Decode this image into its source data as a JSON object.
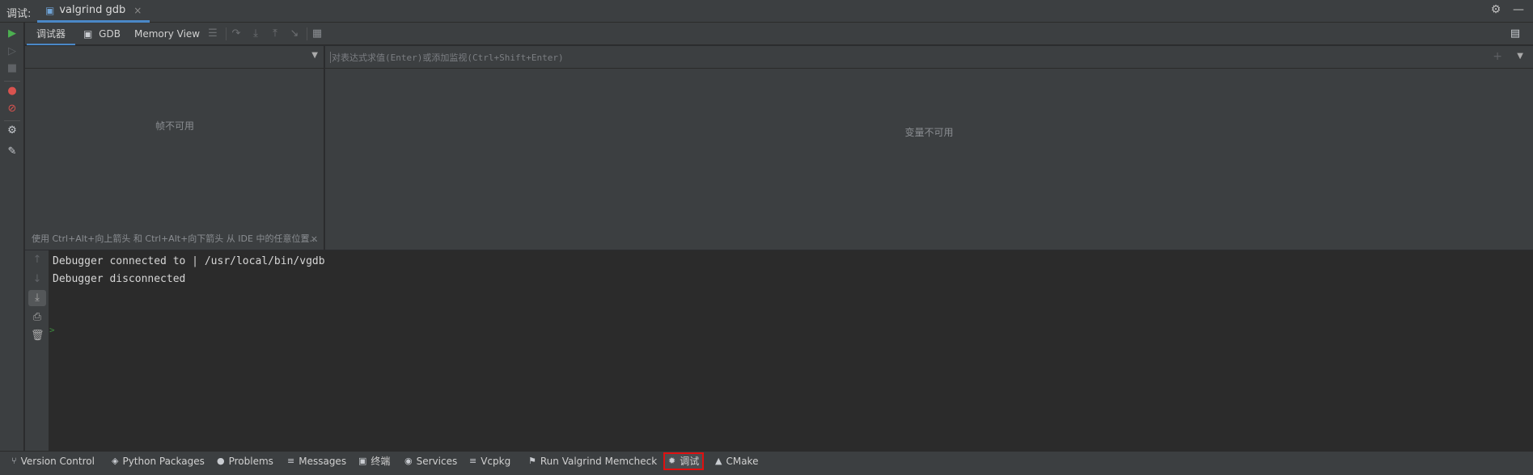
{
  "titlebar": {
    "label": "调试:",
    "session_tab": "valgrind gdb",
    "close_glyph": "×",
    "settings_icon": "gear-icon",
    "minimize_icon": "minimize-icon"
  },
  "debug_tabs": {
    "debugger": "调试器",
    "gdb": "GDB",
    "memory_view": "Memory View"
  },
  "frames": {
    "empty_text": "帧不可用",
    "hint": "使用 Ctrl+Alt+向上箭头 和 Ctrl+Alt+向下箭头 从 IDE 中的任意位置...",
    "hint_close": "×"
  },
  "variables": {
    "eval_placeholder": "对表达式求值(Enter)或添加监视(Ctrl+Shift+Enter)",
    "empty_text": "变量不可用"
  },
  "console": {
    "lines": [
      "Debugger connected to | /usr/local/bin/vgdb",
      "Debugger disconnected"
    ],
    "prompt": ">"
  },
  "bottom_bar": {
    "items": [
      {
        "label": "Version Control",
        "icon": "branch-icon"
      },
      {
        "label": "Python Packages",
        "icon": "layers-icon"
      },
      {
        "label": "Problems",
        "icon": "info-icon"
      },
      {
        "label": "Messages",
        "icon": "list-icon"
      },
      {
        "label": "终端",
        "icon": "terminal-icon"
      },
      {
        "label": "Services",
        "icon": "services-icon"
      },
      {
        "label": "Vcpkg",
        "icon": "list-icon"
      },
      {
        "label": "Run Valgrind Memcheck",
        "icon": "run-valgrind-icon"
      },
      {
        "label": "调试",
        "icon": "bug-icon",
        "active": true
      },
      {
        "label": "CMake",
        "icon": "triangle-icon"
      }
    ]
  },
  "colors": {
    "accent": "#4a88c7",
    "active_highlight": "#e01010",
    "background": "#2b2d30",
    "panel": "#3c3f41"
  }
}
